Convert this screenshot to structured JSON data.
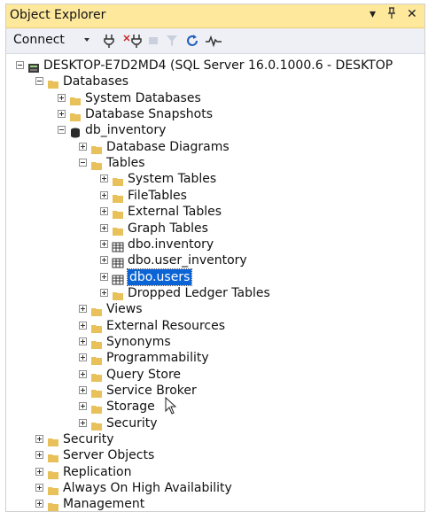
{
  "panel": {
    "title": "Object Explorer",
    "pin_glyph": "▾",
    "dock_glyph": "ᵖ",
    "close_glyph": "✕"
  },
  "toolbar": {
    "connect_label": "Connect",
    "icons": [
      "connect-object-icon",
      "disconnect-icon",
      "stop-icon",
      "filter-icon",
      "refresh-icon",
      "activity-monitor-icon"
    ]
  },
  "colors": {
    "titlebar": "#fde89c",
    "selection": "#0a64d6",
    "folder": "#e9c15a"
  },
  "tree": [
    {
      "label": "DESKTOP-E7D2MD4 (SQL Server 16.0.1000.6 - DESKTOP",
      "level": 0,
      "expander": "minus",
      "icon": "server-icon"
    },
    {
      "label": "Databases",
      "level": 1,
      "expander": "minus",
      "icon": "folder-icon"
    },
    {
      "label": "System Databases",
      "level": 2,
      "expander": "plus",
      "icon": "folder-icon"
    },
    {
      "label": "Database Snapshots",
      "level": 2,
      "expander": "plus",
      "icon": "folder-icon"
    },
    {
      "label": "db_inventory",
      "level": 2,
      "expander": "minus",
      "icon": "database-icon"
    },
    {
      "label": "Database Diagrams",
      "level": 3,
      "expander": "plus",
      "icon": "folder-icon"
    },
    {
      "label": "Tables",
      "level": 3,
      "expander": "minus",
      "icon": "folder-icon"
    },
    {
      "label": "System Tables",
      "level": 4,
      "expander": "plus",
      "icon": "folder-icon"
    },
    {
      "label": "FileTables",
      "level": 4,
      "expander": "plus",
      "icon": "folder-icon"
    },
    {
      "label": "External Tables",
      "level": 4,
      "expander": "plus",
      "icon": "folder-icon"
    },
    {
      "label": "Graph Tables",
      "level": 4,
      "expander": "plus",
      "icon": "folder-icon"
    },
    {
      "label": "dbo.inventory",
      "level": 4,
      "expander": "plus",
      "icon": "table-icon"
    },
    {
      "label": "dbo.user_inventory",
      "level": 4,
      "expander": "plus",
      "icon": "table-icon"
    },
    {
      "label": "dbo.users",
      "level": 4,
      "expander": "plus",
      "icon": "table-icon",
      "selected": true
    },
    {
      "label": "Dropped Ledger Tables",
      "level": 4,
      "expander": "plus",
      "icon": "folder-icon"
    },
    {
      "label": "Views",
      "level": 3,
      "expander": "plus",
      "icon": "folder-icon"
    },
    {
      "label": "External Resources",
      "level": 3,
      "expander": "plus",
      "icon": "folder-icon"
    },
    {
      "label": "Synonyms",
      "level": 3,
      "expander": "plus",
      "icon": "folder-icon"
    },
    {
      "label": "Programmability",
      "level": 3,
      "expander": "plus",
      "icon": "folder-icon"
    },
    {
      "label": "Query Store",
      "level": 3,
      "expander": "plus",
      "icon": "folder-icon"
    },
    {
      "label": "Service Broker",
      "level": 3,
      "expander": "plus",
      "icon": "folder-icon"
    },
    {
      "label": "Storage",
      "level": 3,
      "expander": "plus",
      "icon": "folder-icon"
    },
    {
      "label": "Security",
      "level": 3,
      "expander": "plus",
      "icon": "folder-icon"
    },
    {
      "label": "Security",
      "level": 1,
      "expander": "plus",
      "icon": "folder-icon"
    },
    {
      "label": "Server Objects",
      "level": 1,
      "expander": "plus",
      "icon": "folder-icon"
    },
    {
      "label": "Replication",
      "level": 1,
      "expander": "plus",
      "icon": "folder-icon"
    },
    {
      "label": "Always On High Availability",
      "level": 1,
      "expander": "plus",
      "icon": "folder-icon"
    },
    {
      "label": "Management",
      "level": 1,
      "expander": "plus",
      "icon": "folder-icon"
    }
  ]
}
